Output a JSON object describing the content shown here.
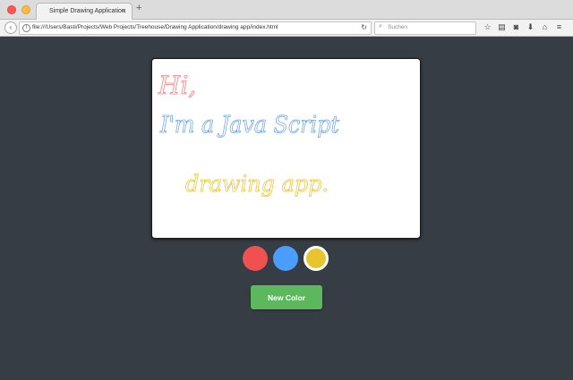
{
  "browser": {
    "tab_title": "Simple Drawing Application",
    "tab_close": "×",
    "new_tab": "+",
    "url": "file:///Users/Basti/Projects/Web Projects/Treehouse/Drawing Application/drawing app/index.html",
    "search_placeholder": "Suchen"
  },
  "drawing": {
    "strokes": [
      {
        "text": "Hi,",
        "color": "#f08080"
      },
      {
        "text": "I'm a Java Script",
        "color": "#6fa6e0"
      },
      {
        "text": "drawing app.",
        "color": "#e8c53a"
      }
    ]
  },
  "controls": {
    "swatches": [
      {
        "color": "#f15050",
        "selected": false
      },
      {
        "color": "#4a9eff",
        "selected": false
      },
      {
        "color": "#e8c42f",
        "selected": true
      }
    ],
    "new_color_label": "New Color",
    "new_color_bg": "#5cb85c"
  },
  "colors": {
    "page_bg": "#363d45"
  }
}
